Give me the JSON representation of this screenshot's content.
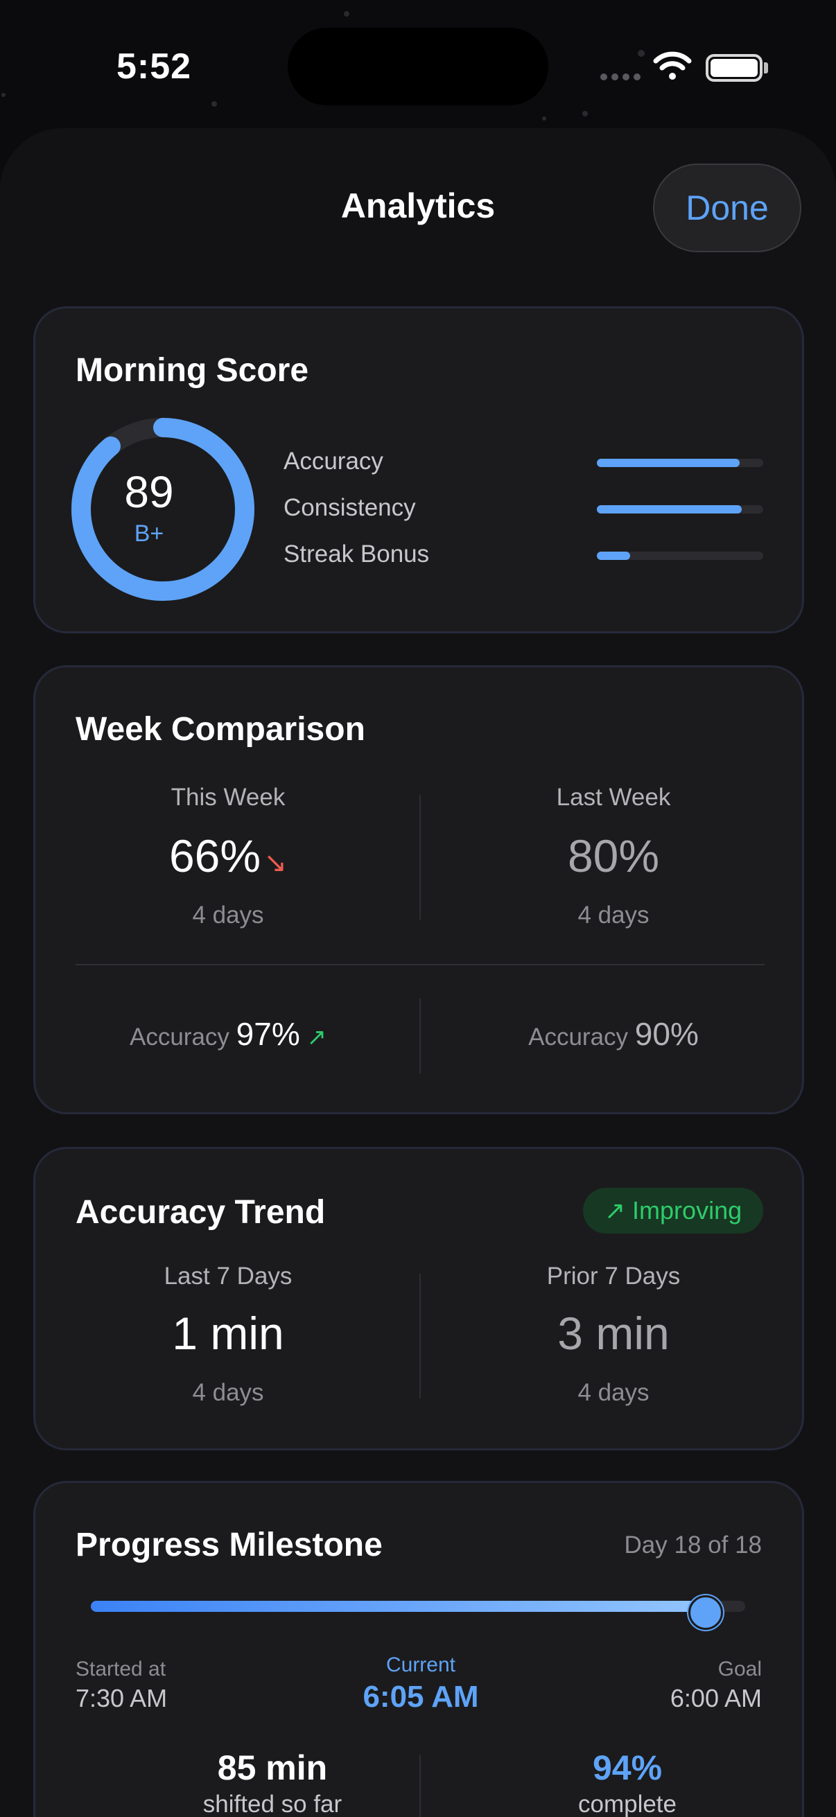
{
  "status_bar": {
    "time": "5:52"
  },
  "header": {
    "title": "Analytics",
    "done_label": "Done"
  },
  "morning_score": {
    "title": "Morning Score",
    "score": "89",
    "grade": "B+",
    "ring_fraction": 0.89,
    "metrics": [
      {
        "label": "Accuracy",
        "fraction": 0.86
      },
      {
        "label": "Consistency",
        "fraction": 0.87
      },
      {
        "label": "Streak Bonus",
        "fraction": 0.2
      }
    ]
  },
  "week_comparison": {
    "title": "Week Comparison",
    "this_week": {
      "label": "This Week",
      "value": "66%",
      "trend": "↘",
      "days": "4 days",
      "accuracy_label": "Accuracy",
      "accuracy": "97%",
      "accuracy_trend": "↗"
    },
    "last_week": {
      "label": "Last Week",
      "value": "80%",
      "days": "4 days",
      "accuracy_label": "Accuracy",
      "accuracy": "90%"
    }
  },
  "accuracy_trend": {
    "title": "Accuracy Trend",
    "badge": {
      "icon": "↗",
      "label": "Improving"
    },
    "last": {
      "label": "Last 7 Days",
      "value": "1 min",
      "days": "4 days"
    },
    "prior": {
      "label": "Prior 7 Days",
      "value": "3 min",
      "days": "4 days"
    }
  },
  "progress": {
    "title": "Progress Milestone",
    "day_of": "Day 18 of 18",
    "fraction": 0.94,
    "started_label": "Started at",
    "started_value": "7:30 AM",
    "current_label": "Current",
    "current_value": "6:05 AM",
    "goal_label": "Goal",
    "goal_value": "6:00 AM",
    "shifted_value": "85 min",
    "shifted_label": "shifted so far",
    "complete_value": "94%",
    "complete_label": "complete"
  },
  "colors": {
    "accent": "#5ea3f7",
    "positive": "#2ecb6b",
    "negative": "#ee5a4f",
    "card": "#1b1b1d"
  }
}
